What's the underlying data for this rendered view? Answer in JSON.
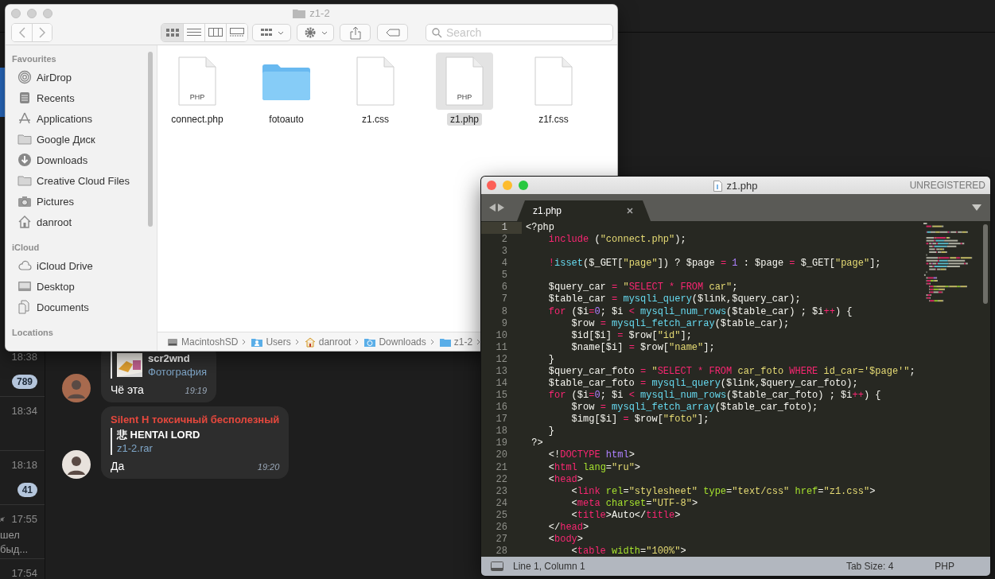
{
  "telegram": {
    "chat_list": [
      {
        "selected": true,
        "muted": false
      },
      {
        "selected": false,
        "muted": false,
        "time": "18:38",
        "badge": "789"
      },
      {
        "selected": false,
        "muted": false,
        "time": "18:34"
      },
      {
        "selected": false,
        "muted": false,
        "time": "18:18",
        "badge": "41"
      },
      {
        "selected": false,
        "muted": true,
        "time": "17:55",
        "preview": [
          "шел",
          "быд..."
        ]
      },
      {
        "selected": false,
        "muted": false,
        "time": "17:54"
      }
    ],
    "messages": [
      {
        "reply": {
          "title": "scr2wnd",
          "text": "Фотография",
          "kind": "picture"
        },
        "text": "Чё эта",
        "time": "19:19"
      },
      {
        "sender": "Silent H токсичный бесполезный",
        "reply": {
          "title": "悲 HENTAI LORD",
          "text": "z1-2.rar"
        },
        "text": "Да",
        "time": "19:20"
      }
    ]
  },
  "finder": {
    "title": "z1-2",
    "search": {
      "placeholder": "Search"
    },
    "sidebar": [
      {
        "title": "Favourites",
        "items": [
          {
            "label": "AirDrop",
            "kind": "airdrop"
          },
          {
            "label": "Recents",
            "kind": "recents"
          },
          {
            "label": "Applications",
            "kind": "apps"
          },
          {
            "label": "Google Диск",
            "kind": "folder"
          },
          {
            "label": "Downloads",
            "kind": "download"
          },
          {
            "label": "Creative Cloud Files",
            "kind": "folder"
          },
          {
            "label": "Pictures",
            "kind": "camera"
          },
          {
            "label": "danroot",
            "kind": "home"
          }
        ]
      },
      {
        "title": "iCloud",
        "items": [
          {
            "label": "iCloud Drive",
            "kind": "cloud"
          },
          {
            "label": "Desktop",
            "kind": "desktop"
          },
          {
            "label": "Documents",
            "kind": "documents"
          }
        ]
      },
      {
        "title": "Locations"
      }
    ],
    "files": [
      {
        "name": "connect.php",
        "kind": "document",
        "label": "PHP",
        "selected": false
      },
      {
        "name": "fotoauto",
        "kind": "folder",
        "selected": false
      },
      {
        "name": "z1.css",
        "kind": "document",
        "selected": false
      },
      {
        "name": "z1.php",
        "kind": "document",
        "label": "PHP",
        "selected": true
      },
      {
        "name": "z1f.css",
        "kind": "document",
        "selected": false
      }
    ],
    "path": [
      {
        "label": "MacintoshSD",
        "kind": "disk"
      },
      {
        "label": "Users",
        "kind": "user-folder"
      },
      {
        "label": "danroot",
        "kind": "home"
      },
      {
        "label": "Downloads",
        "kind": "download-folder"
      },
      {
        "label": "z1-2",
        "kind": "folder"
      }
    ]
  },
  "editor": {
    "title": "z1.php",
    "license": "UNREGISTERED",
    "tabs": [
      {
        "label": "z1.php",
        "selected": true
      }
    ],
    "lines": [
      {
        "number": "1",
        "current": true,
        "tokens": [
          {
            "text": "<?php",
            "kind": "plain"
          }
        ]
      },
      {
        "number": "2",
        "current": false,
        "tokens": [
          {
            "text": "    include",
            "kind": "keyword"
          },
          {
            "text": " (",
            "kind": "plain"
          },
          {
            "text": "\"connect.php\"",
            "kind": "string"
          },
          {
            "text": ");",
            "kind": "plain"
          }
        ]
      },
      {
        "number": "3",
        "current": false
      },
      {
        "number": "4",
        "current": false,
        "tokens": [
          {
            "text": "    !",
            "kind": "keyword"
          },
          {
            "text": "isset",
            "kind": "function"
          },
          {
            "text": "($_GET[",
            "kind": "plain"
          },
          {
            "text": "\"page\"",
            "kind": "string"
          },
          {
            "text": "]) ? $page ",
            "kind": "plain"
          },
          {
            "text": "= ",
            "kind": "keyword"
          },
          {
            "text": "1",
            "kind": "number"
          },
          {
            "text": " : $page ",
            "kind": "plain"
          },
          {
            "text": "=",
            "kind": "keyword"
          },
          {
            "text": " $_GET[",
            "kind": "plain"
          },
          {
            "text": "\"page\"",
            "kind": "string"
          },
          {
            "text": "];",
            "kind": "plain"
          }
        ]
      },
      {
        "number": "5",
        "current": false
      },
      {
        "number": "6",
        "current": false,
        "tokens": [
          {
            "text": "    $query_car ",
            "kind": "plain"
          },
          {
            "text": "= ",
            "kind": "keyword"
          },
          {
            "text": "\"",
            "kind": "string"
          },
          {
            "text": "SELECT * FROM",
            "kind": "keyword"
          },
          {
            "text": " car\"",
            "kind": "string"
          },
          {
            "text": ";",
            "kind": "plain"
          }
        ]
      },
      {
        "number": "7",
        "current": false,
        "tokens": [
          {
            "text": "    $table_car ",
            "kind": "plain"
          },
          {
            "text": "= ",
            "kind": "keyword"
          },
          {
            "text": "mysqli_query",
            "kind": "function"
          },
          {
            "text": "($link,$query_car);",
            "kind": "plain"
          }
        ]
      },
      {
        "number": "8",
        "current": false,
        "tokens": [
          {
            "text": "    for",
            "kind": "keyword"
          },
          {
            "text": " ($i",
            "kind": "plain"
          },
          {
            "text": "=",
            "kind": "keyword"
          },
          {
            "text": "0",
            "kind": "number"
          },
          {
            "text": "; $i ",
            "kind": "plain"
          },
          {
            "text": "< ",
            "kind": "keyword"
          },
          {
            "text": "mysqli_num_rows",
            "kind": "function"
          },
          {
            "text": "($table_car) ; $i",
            "kind": "plain"
          },
          {
            "text": "++",
            "kind": "keyword"
          },
          {
            "text": ") {",
            "kind": "plain"
          }
        ]
      },
      {
        "number": "9",
        "current": false,
        "tokens": [
          {
            "text": "        $row ",
            "kind": "plain"
          },
          {
            "text": "= ",
            "kind": "keyword"
          },
          {
            "text": "mysqli_fetch_array",
            "kind": "function"
          },
          {
            "text": "($table_car);",
            "kind": "plain"
          }
        ]
      },
      {
        "number": "10",
        "current": false,
        "tokens": [
          {
            "text": "        $id[$i] ",
            "kind": "plain"
          },
          {
            "text": "=",
            "kind": "keyword"
          },
          {
            "text": " $row[",
            "kind": "plain"
          },
          {
            "text": "\"id\"",
            "kind": "string"
          },
          {
            "text": "];",
            "kind": "plain"
          }
        ]
      },
      {
        "number": "11",
        "current": false,
        "tokens": [
          {
            "text": "        $name[$i] ",
            "kind": "plain"
          },
          {
            "text": "=",
            "kind": "keyword"
          },
          {
            "text": " $row[",
            "kind": "plain"
          },
          {
            "text": "\"name\"",
            "kind": "string"
          },
          {
            "text": "];",
            "kind": "plain"
          }
        ]
      },
      {
        "number": "12",
        "current": false,
        "tokens": [
          {
            "text": "    }",
            "kind": "plain"
          }
        ]
      },
      {
        "number": "13",
        "current": false,
        "tokens": [
          {
            "text": "    $query_car_foto ",
            "kind": "plain"
          },
          {
            "text": "= ",
            "kind": "keyword"
          },
          {
            "text": "\"",
            "kind": "string"
          },
          {
            "text": "SELECT * FROM",
            "kind": "keyword"
          },
          {
            "text": " car_foto ",
            "kind": "string"
          },
          {
            "text": "WHERE",
            "kind": "keyword"
          },
          {
            "text": " id_car='$page'\"",
            "kind": "string"
          },
          {
            "text": ";",
            "kind": "plain"
          }
        ]
      },
      {
        "number": "14",
        "current": false,
        "tokens": [
          {
            "text": "    $table_car_foto ",
            "kind": "plain"
          },
          {
            "text": "= ",
            "kind": "keyword"
          },
          {
            "text": "mysqli_query",
            "kind": "function"
          },
          {
            "text": "($link,$query_car_foto);",
            "kind": "plain"
          }
        ]
      },
      {
        "number": "15",
        "current": false,
        "tokens": [
          {
            "text": "    for",
            "kind": "keyword"
          },
          {
            "text": " ($i",
            "kind": "plain"
          },
          {
            "text": "=",
            "kind": "keyword"
          },
          {
            "text": "0",
            "kind": "number"
          },
          {
            "text": "; $i ",
            "kind": "plain"
          },
          {
            "text": "< ",
            "kind": "keyword"
          },
          {
            "text": "mysqli_num_rows",
            "kind": "function"
          },
          {
            "text": "($table_car_foto) ; $i",
            "kind": "plain"
          },
          {
            "text": "++",
            "kind": "keyword"
          },
          {
            "text": ") {",
            "kind": "plain"
          }
        ]
      },
      {
        "number": "16",
        "current": false,
        "tokens": [
          {
            "text": "        $row ",
            "kind": "plain"
          },
          {
            "text": "= ",
            "kind": "keyword"
          },
          {
            "text": "mysqli_fetch_array",
            "kind": "function"
          },
          {
            "text": "($table_car_foto);",
            "kind": "plain"
          }
        ]
      },
      {
        "number": "17",
        "current": false,
        "tokens": [
          {
            "text": "        $img[$i] ",
            "kind": "plain"
          },
          {
            "text": "=",
            "kind": "keyword"
          },
          {
            "text": " $row[",
            "kind": "plain"
          },
          {
            "text": "\"foto\"",
            "kind": "string"
          },
          {
            "text": "];",
            "kind": "plain"
          }
        ]
      },
      {
        "number": "18",
        "current": false,
        "tokens": [
          {
            "text": "    }",
            "kind": "plain"
          }
        ]
      },
      {
        "number": "19",
        "current": false,
        "tokens": [
          {
            "text": " ?>",
            "kind": "plain"
          }
        ]
      },
      {
        "number": "20",
        "current": false,
        "tokens": [
          {
            "text": "    <!",
            "kind": "plain"
          },
          {
            "text": "DOCTYPE ",
            "kind": "keyword"
          },
          {
            "text": "html",
            "kind": "number"
          },
          {
            "text": ">",
            "kind": "plain"
          }
        ]
      },
      {
        "number": "21",
        "current": false,
        "tokens": [
          {
            "text": "    <",
            "kind": "plain"
          },
          {
            "text": "html ",
            "kind": "keyword"
          },
          {
            "text": "lang",
            "kind": "attribute"
          },
          {
            "text": "=",
            "kind": "plain"
          },
          {
            "text": "\"ru\"",
            "kind": "string"
          },
          {
            "text": ">",
            "kind": "plain"
          }
        ]
      },
      {
        "number": "22",
        "current": false,
        "tokens": [
          {
            "text": "    <",
            "kind": "plain"
          },
          {
            "text": "head",
            "kind": "keyword"
          },
          {
            "text": ">",
            "kind": "plain"
          }
        ]
      },
      {
        "number": "23",
        "current": false,
        "tokens": [
          {
            "text": "        <",
            "kind": "plain"
          },
          {
            "text": "link ",
            "kind": "keyword"
          },
          {
            "text": "rel",
            "kind": "attribute"
          },
          {
            "text": "=",
            "kind": "plain"
          },
          {
            "text": "\"stylesheet\" ",
            "kind": "string"
          },
          {
            "text": "type",
            "kind": "attribute"
          },
          {
            "text": "=",
            "kind": "plain"
          },
          {
            "text": "\"text/css\" ",
            "kind": "string"
          },
          {
            "text": "href",
            "kind": "attribute"
          },
          {
            "text": "=",
            "kind": "plain"
          },
          {
            "text": "\"z1.css\"",
            "kind": "string"
          },
          {
            "text": ">",
            "kind": "plain"
          }
        ]
      },
      {
        "number": "24",
        "current": false,
        "tokens": [
          {
            "text": "        <",
            "kind": "plain"
          },
          {
            "text": "meta ",
            "kind": "keyword"
          },
          {
            "text": "charset",
            "kind": "attribute"
          },
          {
            "text": "=",
            "kind": "plain"
          },
          {
            "text": "\"UTF-8\"",
            "kind": "string"
          },
          {
            "text": ">",
            "kind": "plain"
          }
        ]
      },
      {
        "number": "25",
        "current": false,
        "tokens": [
          {
            "text": "        <",
            "kind": "plain"
          },
          {
            "text": "title",
            "kind": "keyword"
          },
          {
            "text": ">Auto</",
            "kind": "plain"
          },
          {
            "text": "title",
            "kind": "keyword"
          },
          {
            "text": ">",
            "kind": "plain"
          }
        ]
      },
      {
        "number": "26",
        "current": false,
        "tokens": [
          {
            "text": "    </",
            "kind": "plain"
          },
          {
            "text": "head",
            "kind": "keyword"
          },
          {
            "text": ">",
            "kind": "plain"
          }
        ]
      },
      {
        "number": "27",
        "current": false,
        "tokens": [
          {
            "text": "    <",
            "kind": "plain"
          },
          {
            "text": "body",
            "kind": "keyword"
          },
          {
            "text": ">",
            "kind": "plain"
          }
        ]
      },
      {
        "number": "28",
        "current": false,
        "tokens": [
          {
            "text": "        <",
            "kind": "plain"
          },
          {
            "text": "table ",
            "kind": "keyword"
          },
          {
            "text": "width",
            "kind": "attribute"
          },
          {
            "text": "=",
            "kind": "plain"
          },
          {
            "text": "\"100%\"",
            "kind": "string"
          },
          {
            "text": ">",
            "kind": "plain"
          }
        ]
      }
    ],
    "status": {
      "position": "Line 1, Column 1",
      "tab_size": "Tab Size: 4",
      "syntax": "PHP"
    }
  }
}
